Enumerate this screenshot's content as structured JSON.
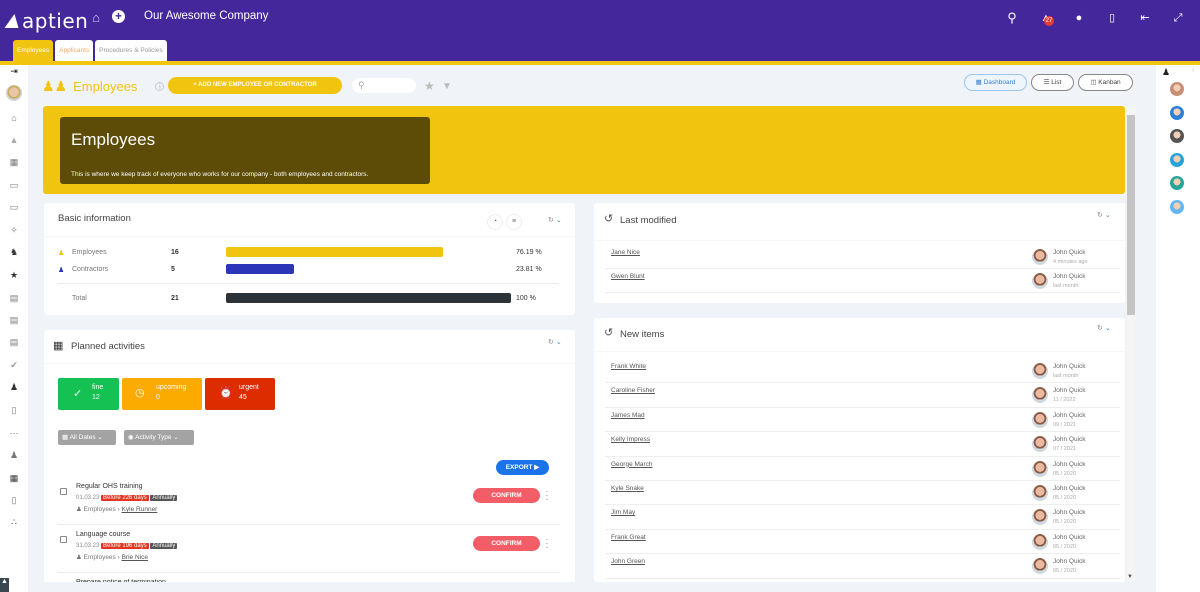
{
  "topbar": {
    "logo": "aptien",
    "company": "Our Awesome Company",
    "notification_count": "27",
    "icons": [
      "home-icon",
      "plus-circle-icon",
      "search-icon",
      "bell-icon",
      "chat-icon",
      "mobile-icon",
      "logout-icon",
      "collapse-icon"
    ]
  },
  "tabs": [
    {
      "label": "Employees",
      "active": true
    },
    {
      "label": "Applicants",
      "active": false
    },
    {
      "label": "Procedures & Policies",
      "active": false
    }
  ],
  "left_sidebar": {
    "icons": [
      "expand-icon",
      "avatar",
      "home-icon",
      "bell-icon",
      "calendar-icon",
      "clipboard-icon",
      "clipboard-check-icon",
      "network-icon",
      "dog-icon",
      "star-icon",
      "document-icon",
      "list-document-icon",
      "document-copy-icon",
      "check-circle-icon",
      "person-icon",
      "books-icon",
      "grid-icon",
      "team-icon",
      "reading-icon",
      "library-icon",
      "org-chart-icon"
    ]
  },
  "page": {
    "title": "Employees",
    "add_button": "+ ADD NEW EMPLOYEE OR CONTRACTOR",
    "search_placeholder": "",
    "views": {
      "dashboard": "Dashboard",
      "list": "List",
      "kanban": "Kanban"
    }
  },
  "banner": {
    "title": "Employees",
    "description": "This is where we keep track of everyone who works for our company - both employees and contractors."
  },
  "basic_information": {
    "title": "Basic information",
    "rows": [
      {
        "label": "Employees",
        "count": "16",
        "percent": "76.19 %",
        "fraction": 0.7619,
        "color": "#f1c40f"
      },
      {
        "label": "Contractors",
        "count": "5",
        "percent": "23.81 %",
        "fraction": 0.2381,
        "color": "#2b35b8"
      }
    ],
    "total": {
      "label": "Total",
      "count": "21",
      "percent": "100 %",
      "fraction": 1.0,
      "color": "#2b3338"
    }
  },
  "planned_activities": {
    "title": "Planned activities",
    "status": [
      {
        "label": "fine",
        "count": "12",
        "color": "#14c152"
      },
      {
        "label": "upcoming",
        "count": "0",
        "color": "#fbaa00"
      },
      {
        "label": "urgent",
        "count": "45",
        "color": "#dd2c00"
      }
    ],
    "filters": {
      "dates": "All Dates",
      "type": "Activity Type"
    },
    "export_label": "EXPORT",
    "items": [
      {
        "title": "Regular OHS training",
        "date": "01.03.23",
        "due": "Before 226 days",
        "recurrence": "Annually",
        "group": "Employees",
        "person": "Kyle Runner",
        "action": "CONFIRM"
      },
      {
        "title": "Language course",
        "date": "31.03.23",
        "due": "Before 196 days",
        "recurrence": "Annually",
        "group": "Employees",
        "person": "Brie Nice",
        "action": "CONFIRM"
      },
      {
        "title": "Prepare notice of termination"
      }
    ]
  },
  "last_modified": {
    "title": "Last modified",
    "items": [
      {
        "name": "Jane Nice",
        "user": "John Quick",
        "time": "4 minutes ago"
      },
      {
        "name": "Gwen Blunt",
        "user": "John Quick",
        "time": "last month"
      }
    ]
  },
  "new_items": {
    "title": "New items",
    "items": [
      {
        "name": "Frank White",
        "user": "John Quick",
        "time": "last month"
      },
      {
        "name": "Caroline Fisher",
        "user": "John Quick",
        "time": "11 / 2022"
      },
      {
        "name": "James Mad",
        "user": "John Quick",
        "time": "09 / 2021"
      },
      {
        "name": "Kelly Impress",
        "user": "John Quick",
        "time": "07 / 2021"
      },
      {
        "name": "George March",
        "user": "John Quick",
        "time": "05 / 2020"
      },
      {
        "name": "Kyle Snake",
        "user": "John Quick",
        "time": "05 / 2020"
      },
      {
        "name": "Jim May",
        "user": "John Quick",
        "time": "05 / 2020"
      },
      {
        "name": "Frank Great",
        "user": "John Quick",
        "time": "05 / 2020"
      },
      {
        "name": "John Green",
        "user": "John Quick",
        "time": "05 / 2020"
      }
    ]
  },
  "right_sidebar": {
    "avatar_colors": [
      "#c98f75",
      "#2f7fd6",
      "#555",
      "#2aa3d8",
      "#26a69a",
      "#64b5f6"
    ]
  }
}
